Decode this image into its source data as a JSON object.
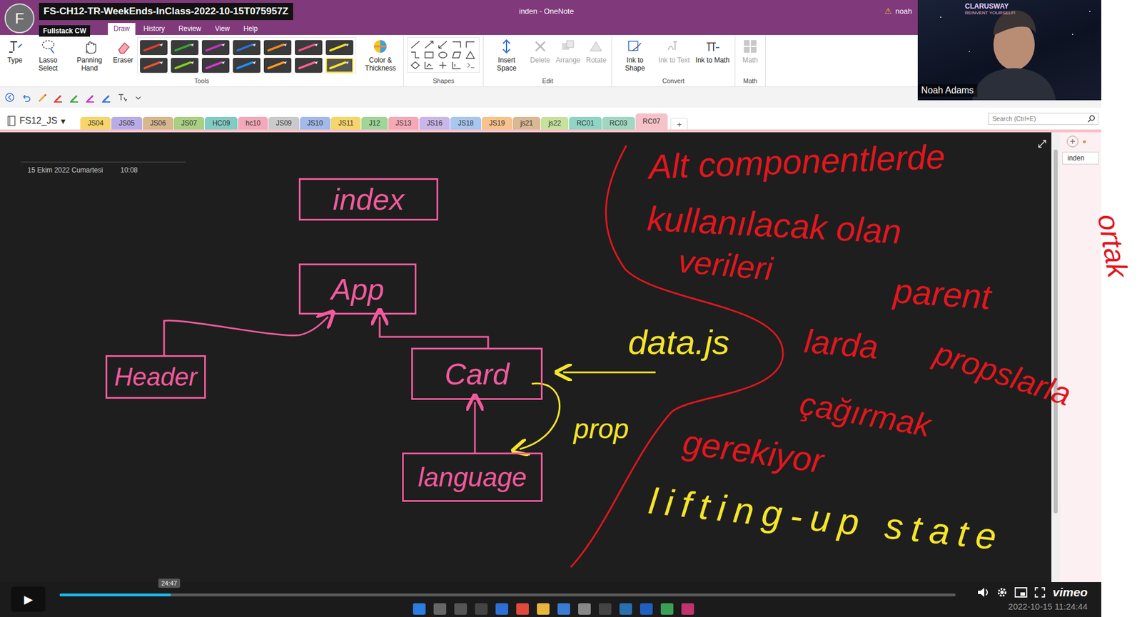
{
  "window": {
    "title": "inden - OneNote",
    "warning": "⚠",
    "user": "noah"
  },
  "video_overlay": {
    "avatar": "F",
    "title": "FS-CH12-TR-WeekEnds-InClass-2022-10-15T075957Z",
    "channel": "Fullstack CW"
  },
  "ribbon_tabs": [
    {
      "label": "Draw",
      "selected": true
    },
    {
      "label": "History",
      "selected": false
    },
    {
      "label": "Review",
      "selected": false
    },
    {
      "label": "View",
      "selected": false
    },
    {
      "label": "Help",
      "selected": false
    }
  ],
  "ribbon_groups": [
    {
      "label": "Tools",
      "kind": "tools",
      "buttons": [
        {
          "label": "Type",
          "disabled": false
        },
        {
          "label": "Lasso Select",
          "disabled": false
        },
        {
          "label": "Panning Hand",
          "disabled": false
        },
        {
          "label": "Eraser",
          "disabled": false
        },
        {
          "label": "Color & Thickness",
          "disabled": false
        }
      ]
    },
    {
      "label": "Shapes",
      "kind": "shapes",
      "buttons": []
    },
    {
      "label": "Edit",
      "kind": "buttons",
      "buttons": [
        {
          "label": "Insert Space",
          "disabled": false
        },
        {
          "label": "Delete",
          "disabled": true
        },
        {
          "label": "Arrange",
          "disabled": true
        },
        {
          "label": "Rotate",
          "disabled": true
        }
      ]
    },
    {
      "label": "Convert",
      "kind": "buttons",
      "buttons": [
        {
          "label": "Ink to Shape",
          "disabled": false
        },
        {
          "label": "Ink to Text",
          "disabled": true
        },
        {
          "label": "Ink to Math",
          "disabled": false
        }
      ]
    },
    {
      "label": "Math",
      "kind": "buttons",
      "buttons": [
        {
          "label": "Math",
          "disabled": true
        }
      ]
    }
  ],
  "pens": [
    {
      "color": "#e03c31",
      "selected": false
    },
    {
      "color": "#38a538",
      "selected": false
    },
    {
      "color": "#c433c4",
      "selected": false
    },
    {
      "color": "#2e6fd6",
      "selected": false
    },
    {
      "color": "#f08a1e",
      "selected": false
    },
    {
      "color": "#e94e8a",
      "selected": false
    },
    {
      "color": "#f5e01e",
      "selected": false
    },
    {
      "color": "#e8523e",
      "selected": false
    },
    {
      "color": "#7ed321",
      "selected": false
    },
    {
      "color": "#d13ad1",
      "selected": false
    },
    {
      "color": "#1f8fff",
      "selected": false
    },
    {
      "color": "#ff9a1f",
      "selected": false
    },
    {
      "color": "#ff5f99",
      "selected": false
    },
    {
      "color": "#ffe82a",
      "selected": true
    }
  ],
  "notebook": {
    "name": "FS12_JS",
    "dropdown": "▾",
    "add": "+",
    "search": {
      "placeholder": "Search (Ctrl+E)"
    },
    "sections": [
      {
        "label": "JS04",
        "color": "#f6d66b",
        "selected": false
      },
      {
        "label": "JS05",
        "color": "#b9ace6",
        "selected": false
      },
      {
        "label": "JS06",
        "color": "#d8b68e",
        "selected": false
      },
      {
        "label": "JS07",
        "color": "#a8cf83",
        "selected": false
      },
      {
        "label": "HC09",
        "color": "#82cbc2",
        "selected": false
      },
      {
        "label": "hc10",
        "color": "#f3a9ba",
        "selected": false
      },
      {
        "label": "JS09",
        "color": "#cacaca",
        "selected": false
      },
      {
        "label": "JS10",
        "color": "#a2b9e9",
        "selected": false
      },
      {
        "label": "JS11",
        "color": "#f6d66b",
        "selected": false
      },
      {
        "label": "J12",
        "color": "#9fd597",
        "selected": false
      },
      {
        "label": "JS13",
        "color": "#f5a9b6",
        "selected": false
      },
      {
        "label": "JS16",
        "color": "#c9b7e9",
        "selected": false
      },
      {
        "label": "JS18",
        "color": "#a9c6ef",
        "selected": false
      },
      {
        "label": "JS19",
        "color": "#f7c28b",
        "selected": false
      },
      {
        "label": "js21",
        "color": "#dab893",
        "selected": false
      },
      {
        "label": "js22",
        "color": "#c7e29c",
        "selected": false
      },
      {
        "label": "RC01",
        "color": "#90d4c4",
        "selected": false
      },
      {
        "label": "RC03",
        "color": "#9fd7c1",
        "selected": false
      },
      {
        "label": "RC07",
        "color": "#f6c2ca",
        "selected": true
      }
    ]
  },
  "page": {
    "date": "15 Ekim 2022 Cumartesi",
    "time": "10:08"
  },
  "pages_panel": {
    "add": "+",
    "pages": [
      {
        "label": "inden",
        "selected": true
      }
    ]
  },
  "diagram": {
    "nodes": [
      {
        "label": "index"
      },
      {
        "label": "App"
      },
      {
        "label": "Header"
      },
      {
        "label": "Card"
      },
      {
        "label": "language"
      }
    ],
    "data_source": "data.js",
    "edge_label": "prop"
  },
  "notes": [
    {
      "text": "Alt componentlerde",
      "color": "#e3161e"
    },
    {
      "text": "kullanılacak olan",
      "color": "#e3161e"
    },
    {
      "text": "verileri",
      "color": "#e3161e"
    },
    {
      "text": "parent",
      "color": "#e3161e"
    },
    {
      "text": "larda",
      "color": "#e3161e"
    },
    {
      "text": "propslarla",
      "color": "#e3161e"
    },
    {
      "text": "çağırmak",
      "color": "#e3161e"
    },
    {
      "text": "gerekiyor",
      "color": "#e3161e"
    },
    {
      "text": "lifting-up state",
      "color": "#f5e52a"
    },
    {
      "text": "ortak",
      "color": "#e3161e"
    }
  ],
  "webcam": {
    "name": "Noah Adams",
    "logo": "CLARUSWAY",
    "tagline": "REINVENT YOURSELF!"
  },
  "player": {
    "play": "▶",
    "level": 0.124,
    "tooltip": "24:47",
    "logo": "vimeo",
    "timestamp": "2022-10-15 11:24:44"
  }
}
